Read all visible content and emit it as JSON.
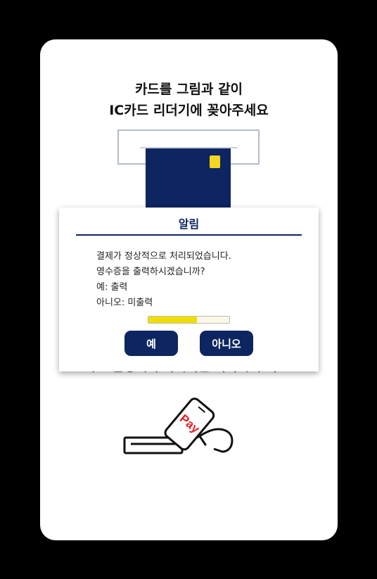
{
  "instruction": {
    "line1": "카드를 그림과 같이",
    "line2": "IC카드 리더기에 꽂아주세요"
  },
  "dialog": {
    "title": "알림",
    "messages": [
      "결제가 정상적으로 처리되었습니다.",
      "영수증을 출력하시겠습니까?",
      "예: 출력",
      "아니오: 미출력"
    ],
    "progress": 0.6,
    "yes_label": "예",
    "no_label": "아니오"
  },
  "background_hint": "카드 삼성페이 하시려면 터치해 주세요.",
  "illustration": {
    "pay_label": "Pay"
  },
  "colors": {
    "navy": "#0d2560",
    "chip": "#f4d71e",
    "pay_red": "#e31c23",
    "progress": "#f0de00"
  }
}
